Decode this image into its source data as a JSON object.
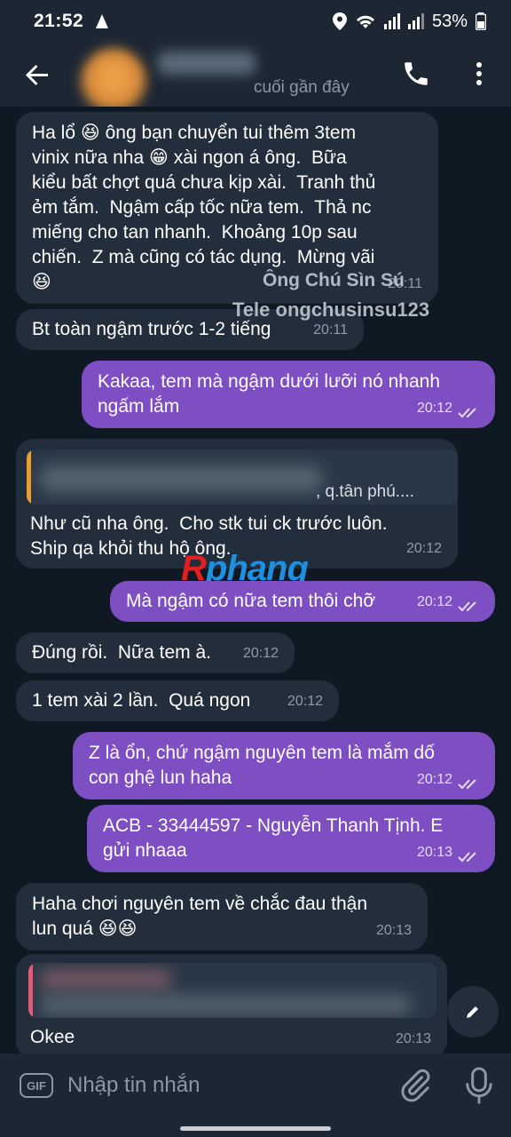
{
  "status_bar": {
    "time": "21:52",
    "battery": "53%",
    "icons": [
      "navigation-icon",
      "location-icon",
      "wifi-icon",
      "signal-icon",
      "signal-icon",
      "battery-icon"
    ]
  },
  "header": {
    "last_seen": "cuối gần đây",
    "icons": [
      "back-arrow-icon",
      "phone-icon",
      "more-vert-icon"
    ]
  },
  "watermark": {
    "line1": "Ông Chú Sìn Sú",
    "line2": "Tele ongchusinsu123"
  },
  "logo": {
    "part1": "R",
    "part2": "phang"
  },
  "messages": [
    {
      "dir": "in",
      "text": "Ha lổ 😆 ông bạn chuyển tui thêm 3tem\nvinix nữa nha 😁 xài ngon á ông.  Bữa\nkiểu bất chợt quá chưa kịp xài.  Tranh thủ\nẻm tắm.  Ngậm cấp tốc nữa tem.  Thả nc\nmiếng cho tan nhanh.  Khoảng 10p sau\nchiến.  Z mà cũng có tác dụng.  Mừng vãi\n😆",
      "time": "20:11"
    },
    {
      "dir": "in",
      "text": "Bt toàn ngậm trước 1-2 tiếng",
      "time": "20:11"
    },
    {
      "dir": "out",
      "text": "Kakaa, tem mà ngậm dưới lưỡi nó nhanh\nngấm lắm",
      "time": "20:12"
    },
    {
      "dir": "in",
      "reply_tail": ", q.tân phú....",
      "text": "Như cũ nha ông.  Cho stk tui ck trước luôn.\nShip qa khỏi thu hộ ông.",
      "time": "20:12"
    },
    {
      "dir": "out",
      "text": "Mà ngậm có nữa tem thôi chỡ",
      "time": "20:12"
    },
    {
      "dir": "in",
      "text": "Đúng rồi.  Nữa tem à.",
      "time": "20:12"
    },
    {
      "dir": "in",
      "text": "1 tem xài 2 lần.  Quá ngon",
      "time": "20:12"
    },
    {
      "dir": "out",
      "text": "Z là ổn, chứ ngậm nguyên tem là mắm dố\ncon ghệ lun haha",
      "time": "20:12"
    },
    {
      "dir": "out",
      "text": "ACB - 33444597 - Nguyễn Thanh Tịnh. E\ngửi nhaaa",
      "time": "20:13"
    },
    {
      "dir": "in",
      "text": "Haha chơi nguyên tem về chắc đau thận\nlun quá 😆😆",
      "time": "20:13"
    },
    {
      "dir": "in",
      "text": "Okee",
      "time": "20:13"
    }
  ],
  "composer": {
    "gif_label": "GIF",
    "placeholder": "Nhập tin nhắn",
    "icons": [
      "gif-icon",
      "paperclip-icon",
      "microphone-icon"
    ]
  },
  "colors": {
    "incoming_bubble": "#222e3b",
    "outgoing_bubble": "#7e4fc2",
    "background": "#0f1923",
    "bar": "#1d2733"
  }
}
